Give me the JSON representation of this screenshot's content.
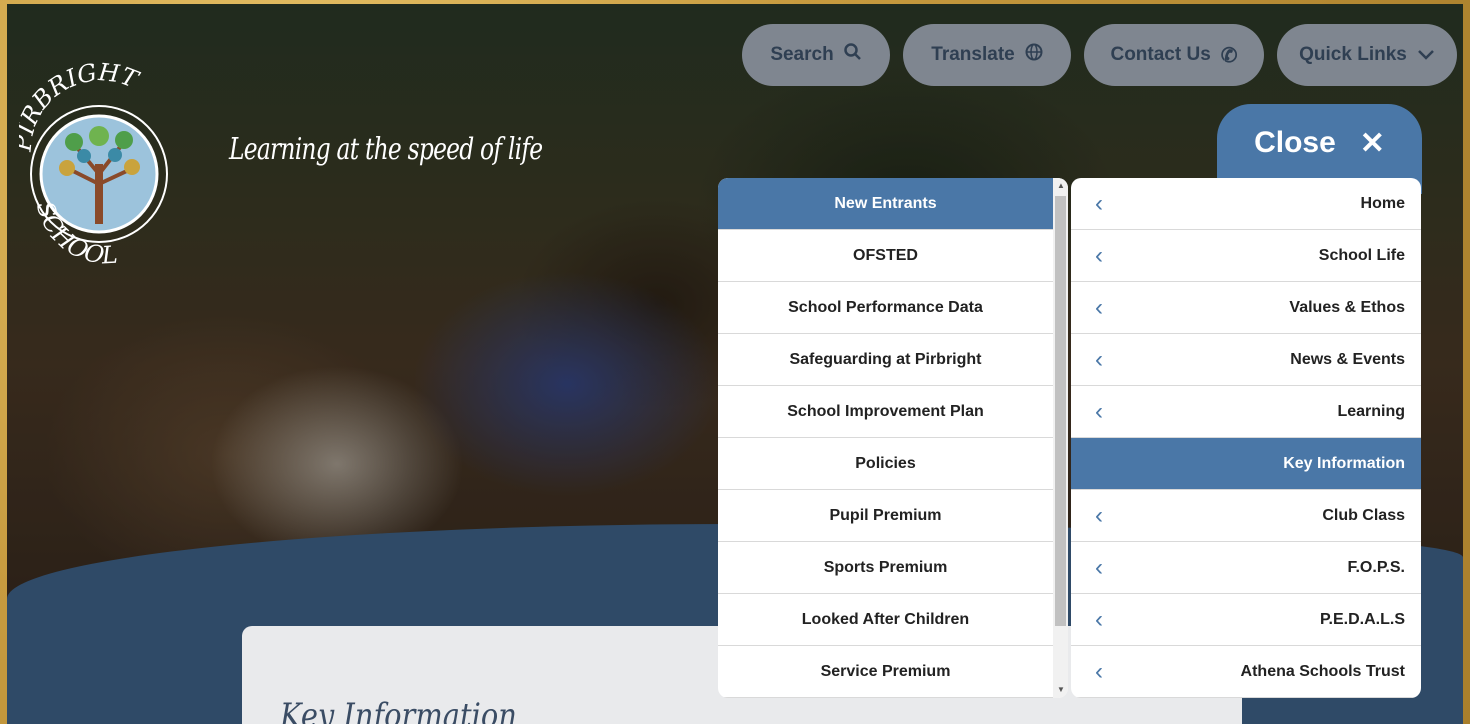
{
  "header": {
    "tagline": "Learning at the speed of life",
    "logo_text_top": "PIRBRIGHT",
    "logo_text_bottom": "SCHOOL"
  },
  "top_buttons": [
    {
      "label": "Search",
      "icon": "search-icon"
    },
    {
      "label": "Translate",
      "icon": "globe-icon"
    },
    {
      "label": "Contact Us",
      "icon": "phone-icon"
    },
    {
      "label": "Quick Links",
      "icon": "chevron-down-icon"
    }
  ],
  "menu": {
    "close_label": "Close",
    "sub_items": [
      {
        "label": "New Entrants",
        "active": true
      },
      {
        "label": "OFSTED"
      },
      {
        "label": "School Performance Data"
      },
      {
        "label": "Safeguarding at Pirbright"
      },
      {
        "label": "School Improvement Plan"
      },
      {
        "label": "Policies"
      },
      {
        "label": "Pupil Premium"
      },
      {
        "label": "Sports Premium"
      },
      {
        "label": "Looked After Children"
      },
      {
        "label": "Service Premium"
      }
    ],
    "main_items": [
      {
        "label": "Home"
      },
      {
        "label": "School Life"
      },
      {
        "label": "Values & Ethos"
      },
      {
        "label": "News & Events"
      },
      {
        "label": "Learning"
      },
      {
        "label": "Key Information",
        "active": true
      },
      {
        "label": "Club Class"
      },
      {
        "label": "F.O.P.S."
      },
      {
        "label": "P.E.D.A.L.S"
      },
      {
        "label": "Athena Schools Trust"
      }
    ]
  },
  "content": {
    "title": "Key Information"
  },
  "colors": {
    "accent": "#4a77a7",
    "frame": "#c79b3f",
    "navy": "#2f4a67"
  }
}
